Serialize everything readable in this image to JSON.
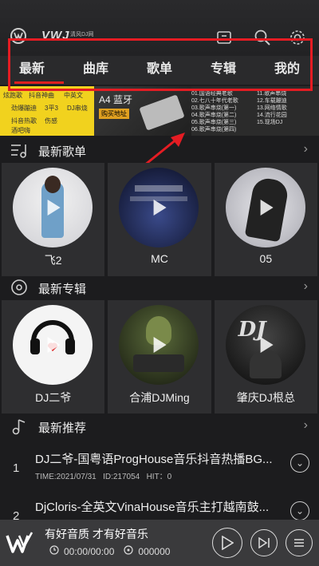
{
  "header": {
    "logo_text": "VWJ",
    "logo_sub": "清风DJ网",
    "icons": [
      "share-icon",
      "search-icon",
      "settings-icon"
    ]
  },
  "tabs": [
    {
      "label": "最新",
      "active": true
    },
    {
      "label": "曲库",
      "active": false
    },
    {
      "label": "歌单",
      "active": false
    },
    {
      "label": "专辑",
      "active": false
    },
    {
      "label": "我的",
      "active": false
    }
  ],
  "banner": {
    "left_rows": [
      "炫跑歌",
      "抖音神曲",
      "中英文",
      "劲爆蹦迪",
      "3平3",
      "DJ串烧",
      "抖音热歌",
      "伤感",
      "酒吧嗨"
    ],
    "mid_title": "A4 蓝牙",
    "mid_badge": "购买地址",
    "list_col1": [
      "01.国语经典老歌",
      "02.七八十年代老歌",
      "03.歌声串烧(第一)",
      "04.歌声串烧(第二)",
      "05.歌声串烧(第三)",
      "06.歌声串烧(第四)"
    ],
    "list_col2": [
      "11.歌声串烧",
      "12.车载蹦迪",
      "13.网络情歌",
      "14.流行花园",
      "15.现场DJ"
    ]
  },
  "section_playlists": {
    "title": "最新歌单",
    "more": "›"
  },
  "playlists": [
    {
      "label": "飞2"
    },
    {
      "label": "MC"
    },
    {
      "label": "05"
    }
  ],
  "section_albums": {
    "title": "最新专辑",
    "more": "›"
  },
  "albums": [
    {
      "label": "DJ二爷"
    },
    {
      "label": "合浦DJMing"
    },
    {
      "label": "肇庆DJ根总"
    }
  ],
  "section_recommend": {
    "title": "最新推荐",
    "more": "›"
  },
  "recommend": [
    {
      "num": "1",
      "name": "DJ二爷-国粤语ProgHouse音乐抖音热播BG...",
      "time": "TIME:2021/07/31",
      "id": "ID:217054",
      "hit": "HIT：0"
    },
    {
      "num": "2",
      "name": "DjCloris-全英文VinaHouse音乐主打越南鼓...",
      "time": "",
      "id": "",
      "hit": ""
    }
  ],
  "player": {
    "slogan": "有好音质 才有好音乐",
    "time": "00:00/00:00",
    "count": "000000"
  },
  "colors": {
    "accent": "#e02020",
    "annotation": "#e51c23"
  }
}
